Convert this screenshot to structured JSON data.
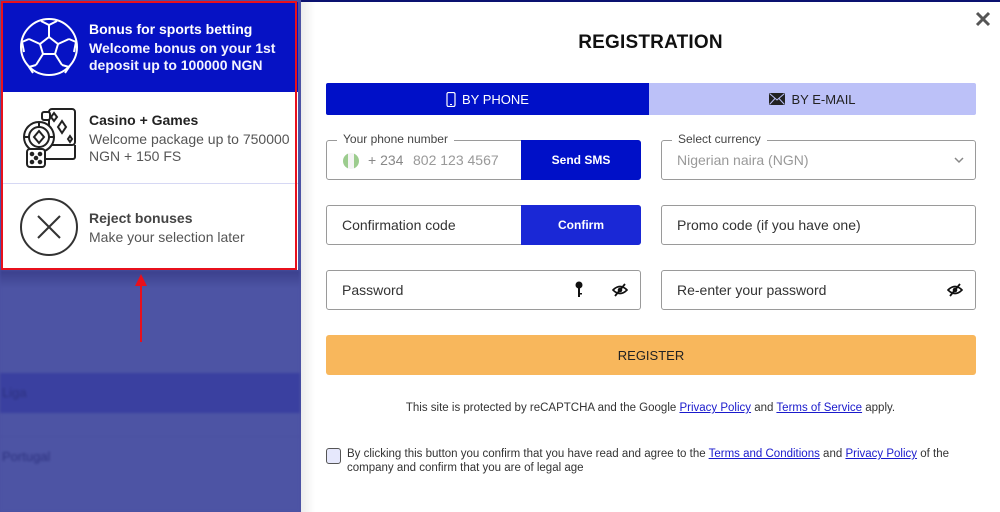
{
  "background": {
    "rows": [
      "Liga",
      "Portugal"
    ]
  },
  "bonus_panel": {
    "items": [
      {
        "icon": "soccer-ball-icon",
        "title": "Bonus for sports betting",
        "description": "Welcome bonus on your 1st deposit up to 100000 NGN",
        "selected": true
      },
      {
        "icon": "casino-cards-chips-dice-icon",
        "title": "Casino + Games",
        "description": "Welcome package up to 750000 NGN + 150 FS",
        "selected": false
      },
      {
        "icon": "reject-x-circle-icon",
        "title": "Reject bonuses",
        "description": "Make your selection later",
        "selected": false
      }
    ]
  },
  "modal": {
    "title": "REGISTRATION",
    "close_icon": "close-icon",
    "tabs": [
      {
        "label": "BY PHONE",
        "icon": "phone-icon",
        "active": true
      },
      {
        "label": "BY E-MAIL",
        "icon": "envelope-icon",
        "active": false
      }
    ],
    "phone": {
      "label": "Your phone number",
      "country_code": "+ 234",
      "placeholder": "802 123 4567",
      "button": "Send SMS"
    },
    "currency": {
      "label": "Select currency",
      "selected": "Nigerian naira (NGN)"
    },
    "confirmation": {
      "placeholder": "Confirmation code",
      "button": "Confirm"
    },
    "promo": {
      "placeholder": "Promo code (if you have one)"
    },
    "password": {
      "placeholder": "Password"
    },
    "repassword": {
      "placeholder": "Re-enter your password"
    },
    "register_button": "REGISTER",
    "recaptcha": {
      "prefix": "This site is protected by reCAPTCHA and the Google ",
      "privacy": "Privacy Policy",
      "and": " and ",
      "terms": "Terms of Service",
      "suffix": " apply."
    },
    "agreement": {
      "prefix": "By clicking this button you confirm that you have read and agree to the ",
      "terms": "Terms and Conditions",
      "and": " and ",
      "privacy": "Privacy Policy",
      "suffix": " of the company and confirm that you are of legal age",
      "checked": false
    }
  },
  "colors": {
    "primary": "#0010c8",
    "tab_inactive": "#bcc1f8",
    "register": "#f8b75c",
    "highlight_outline": "#e8101c",
    "overlay": "#4d54a4"
  }
}
